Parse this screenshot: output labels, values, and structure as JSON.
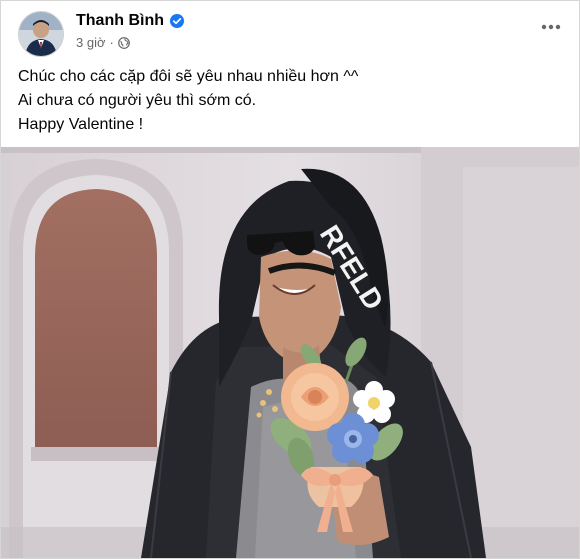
{
  "post": {
    "author": "Thanh Bình",
    "time": "3 giờ",
    "separator": "·",
    "lines": [
      "Chúc cho các cặp đôi sẽ yêu nhau nhiều hơn ^^",
      "Ai chưa có người yêu thì sớm có.",
      "Happy Valentine !"
    ],
    "hood_text": "RFELD"
  },
  "colors": {
    "verified": "#1877f2",
    "meta": "#65676b",
    "text": "#050505"
  },
  "icons": {
    "verified": "verified-badge-icon",
    "audience": "globe-icon",
    "more": "more-options-icon"
  }
}
